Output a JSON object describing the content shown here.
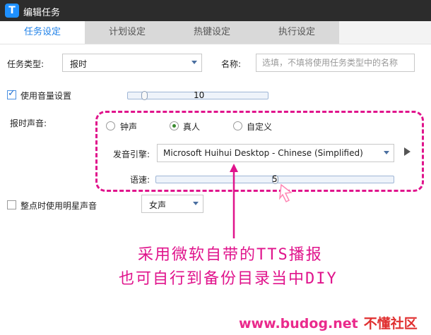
{
  "window": {
    "title": "编辑任务",
    "app_icon_glyph": "T"
  },
  "tabs": [
    {
      "label": "任务设定",
      "active": true
    },
    {
      "label": "计划设定",
      "active": false
    },
    {
      "label": "热键设定",
      "active": false
    },
    {
      "label": "执行设定",
      "active": false
    }
  ],
  "form": {
    "task_type_label": "任务类型:",
    "task_type_value": "报时",
    "name_label": "名称:",
    "name_placeholder": "选填，不填将使用任务类型中的名称",
    "volume_checkbox_label": "使用音量设置",
    "volume_checked": true,
    "volume_value": "10",
    "volume_fraction": 0.1,
    "sound_label": "报时声音:",
    "sound_options": [
      "钟声",
      "真人",
      "自定义"
    ],
    "sound_selected": "真人",
    "engine_label": "发音引擎:",
    "engine_value": "Microsoft Huihui Desktop - Chinese (Simplified)",
    "speed_label": "语速:",
    "speed_value": "5",
    "speed_fraction": 0.5,
    "star_checkbox_label": "整点时使用明星声音",
    "star_checked": false,
    "voice_value": "女声"
  },
  "annotation": {
    "line1": "采用微软自带的TTS播报",
    "line2": "也可自行到备份目录当中DIY",
    "color": "#e0148c"
  },
  "watermark": {
    "site": "www.budog.net",
    "brand": "不懂社区"
  }
}
